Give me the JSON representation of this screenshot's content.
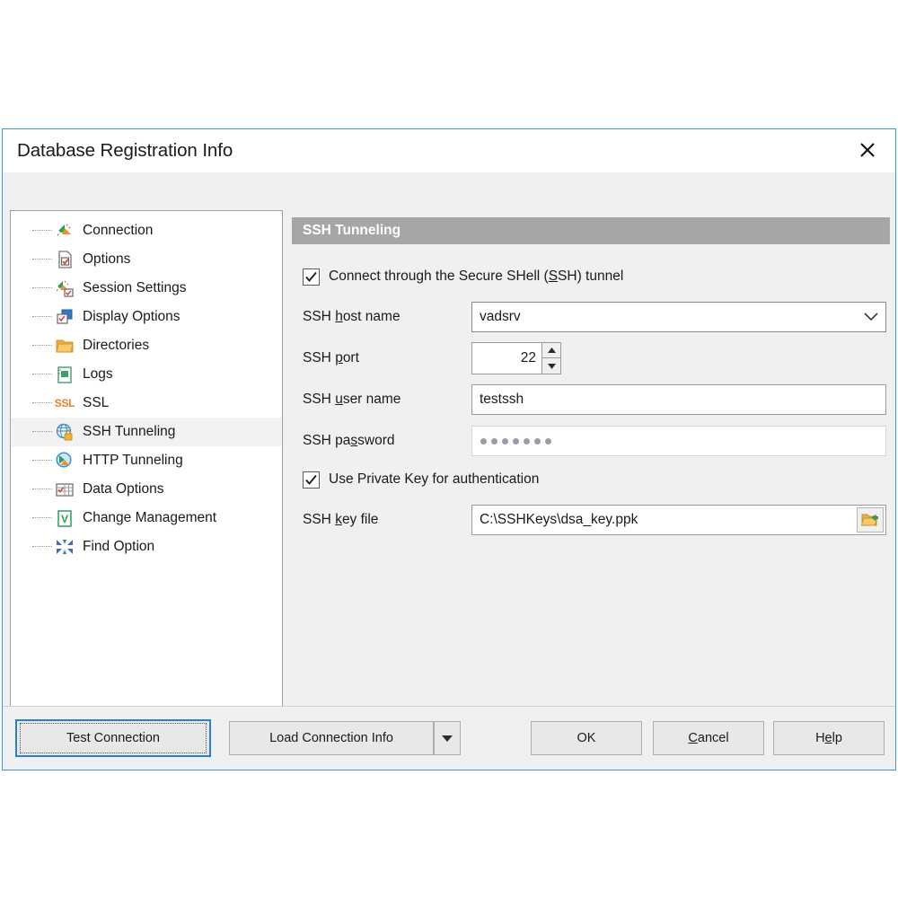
{
  "window": {
    "title": "Database Registration Info",
    "close_icon": "close-icon",
    "accent_color": "#3a96dd"
  },
  "sidebar": {
    "items": [
      {
        "label": "Connection",
        "icon": "connection-plug-icon",
        "selected": false
      },
      {
        "label": "Options",
        "icon": "document-check-icon",
        "selected": false
      },
      {
        "label": "Session Settings",
        "icon": "session-settings-icon",
        "selected": false
      },
      {
        "label": "Display Options",
        "icon": "display-options-icon",
        "selected": false
      },
      {
        "label": "Directories",
        "icon": "folder-icon",
        "selected": false
      },
      {
        "label": "Logs",
        "icon": "logs-notebook-icon",
        "selected": false
      },
      {
        "label": "SSL",
        "icon": "ssl-text-icon",
        "selected": false
      },
      {
        "label": "SSH Tunneling",
        "icon": "globe-lock-icon",
        "selected": true
      },
      {
        "label": "HTTP Tunneling",
        "icon": "globe-arrow-icon",
        "selected": false
      },
      {
        "label": "Data Options",
        "icon": "data-grid-icon",
        "selected": false
      },
      {
        "label": "Change Management",
        "icon": "version-control-icon",
        "selected": false
      },
      {
        "label": "Find Option",
        "icon": "find-option-icon",
        "selected": false
      }
    ]
  },
  "panel": {
    "header": "SSH Tunneling",
    "header_bg": "#a6a6a6",
    "connect_checkbox": {
      "label_before": "Connect through the Secure SHell (",
      "label_accel": "S",
      "label_after": "SH) tunnel",
      "checked": true
    },
    "fields": {
      "host": {
        "label_before": "SSH ",
        "label_accel": "h",
        "label_after": "ost name",
        "value": "vadsrv",
        "type": "combobox"
      },
      "port": {
        "label_before": "SSH ",
        "label_accel": "p",
        "label_after": "ort",
        "value": "22",
        "type": "spinner"
      },
      "user": {
        "label_before": "SSH ",
        "label_accel": "u",
        "label_after": "ser name",
        "value": "testssh",
        "type": "text"
      },
      "password": {
        "label_before": "SSH pa",
        "label_accel": "s",
        "label_after": "sword",
        "value": "•••••••",
        "masked_dots": 7,
        "type": "password"
      },
      "keyfile": {
        "label_before": "SSH ",
        "label_accel": "k",
        "label_after": "ey file",
        "value": "C:\\SSHKeys\\dsa_key.ppk",
        "type": "file",
        "browse_icon": "open-folder-icon"
      }
    },
    "private_key_checkbox": {
      "label": "Use Private Key for authentication",
      "checked": true
    }
  },
  "footer": {
    "test_connection": "Test Connection",
    "load_connection_info": "Load Connection Info",
    "load_dropdown_icon": "chevron-down-icon",
    "ok": "OK",
    "cancel_before": "",
    "cancel_accel": "C",
    "cancel_after": "ancel",
    "help_before": "H",
    "help_accel": "e",
    "help_after": "lp"
  }
}
